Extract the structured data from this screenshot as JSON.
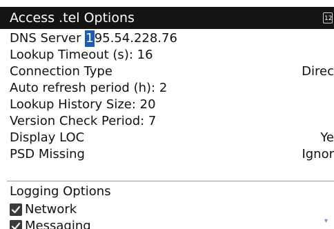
{
  "window": {
    "title": "Access .tel Options",
    "clock_text": "12"
  },
  "settings": {
    "dns_server_label": "DNS Server",
    "dns_server_cursor_char": "1",
    "dns_server_rest": "95.54.228.76",
    "lookup_timeout": "Lookup Timeout (s): 16",
    "connection_type_label": "Connection Type",
    "connection_type_value": "Direc",
    "auto_refresh": "Auto refresh period (h): 2",
    "lookup_history": "Lookup History Size: 20",
    "version_check": "Version Check Period: 7",
    "display_loc_label": "Display LOC",
    "display_loc_value": "Ye",
    "psd_missing_label": "PSD Missing",
    "psd_missing_value": "Ignor"
  },
  "logging": {
    "heading": "Logging Options",
    "items": [
      {
        "label": "Network",
        "checked": true
      },
      {
        "label": "Messaging",
        "checked": true
      }
    ]
  },
  "colors": {
    "title_bg": "#141414",
    "cursor_highlight": "#1a5bbf",
    "separator": "#9a9a9a",
    "checkbox_bg": "#3a3a3a"
  }
}
